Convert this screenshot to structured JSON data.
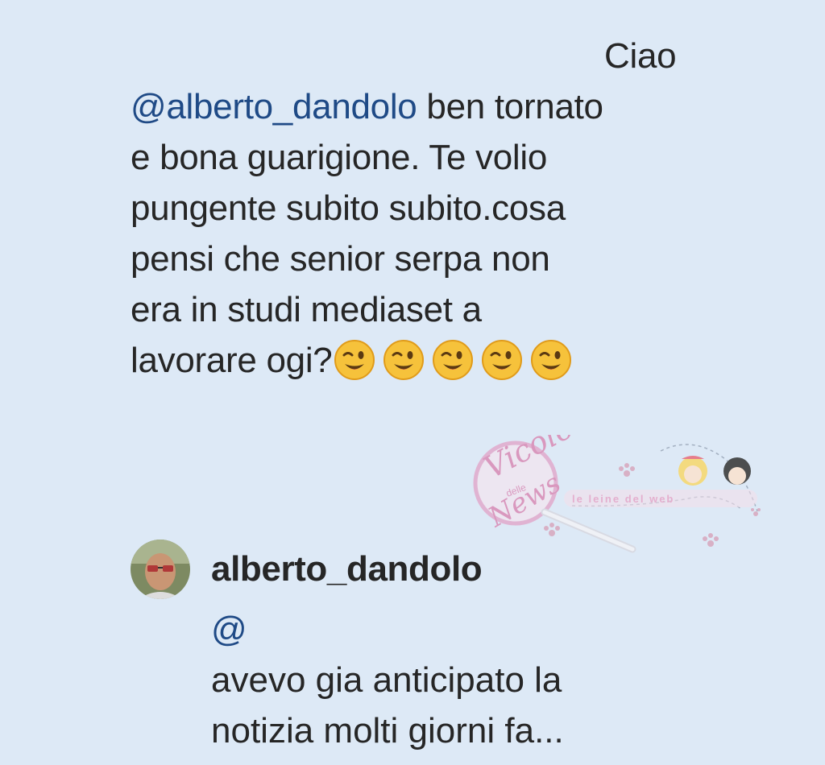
{
  "comment": {
    "lines": [
      {
        "text": "Ciao"
      },
      {
        "mention": "@alberto_dandolo",
        "text": " ben tornato"
      },
      {
        "text": "e bona guarigione. Te volio"
      },
      {
        "text": "pungente subito subito.cosa"
      },
      {
        "text": "pensi che senior serpa non"
      },
      {
        "text": "era in studi mediaset a"
      },
      {
        "text": "lavorare ogi?"
      }
    ],
    "emoji": [
      "winking-face-icon",
      "winking-face-icon",
      "winking-face-icon",
      "winking-face-icon",
      "winking-face-icon"
    ]
  },
  "reply": {
    "username": "alberto_dandolo",
    "mention": "@",
    "lines": [
      "avevo gia anticipato la",
      "notizia molti giorni fa..."
    ]
  },
  "watermark": {
    "logo_text_1": "Vicolo",
    "logo_text_2": "delle",
    "logo_text_3": "News",
    "banner_text": "le leine del web"
  },
  "colors": {
    "background": "#dde9f6",
    "text": "#262626",
    "mention": "#1f4a86",
    "watermark_pink": "#e6a6c8"
  }
}
